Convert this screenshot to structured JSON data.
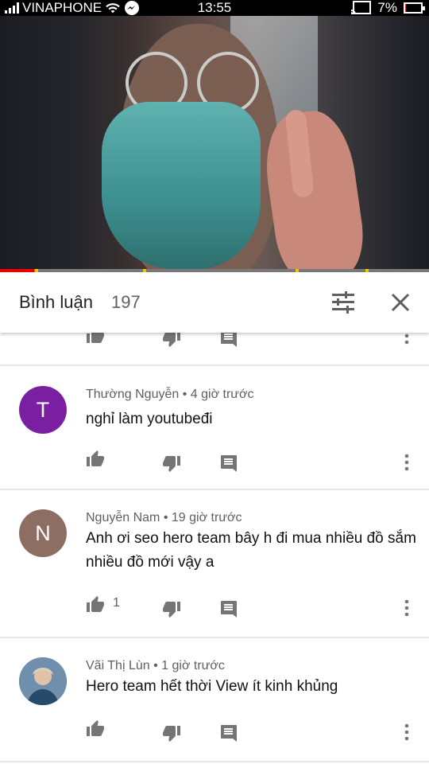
{
  "status_bar": {
    "carrier": "VINAPHONE",
    "time": "13:55",
    "battery": "7%",
    "battery_level": 0.07
  },
  "video": {
    "progress_played": 0.08
  },
  "comments": {
    "title": "Bình luận",
    "count": "197"
  },
  "comment_items": [
    {
      "author": "Thường Nguyễn",
      "time": "4 giờ trước",
      "text": "nghỉ làm youtubeđi",
      "avatar_letter": "T",
      "avatar_color": "#7b1fa2",
      "likes": ""
    },
    {
      "author": "Nguyễn Nam",
      "time": "19 giờ trước",
      "text": "Anh ơi seo hero team bây h đi mua nhiều đồ sắm nhiều đồ mới vậy a",
      "avatar_letter": "N",
      "avatar_color": "#8d6e63",
      "likes": "1"
    },
    {
      "author": "Vãi Thị Lùn",
      "time": "1 giờ trước",
      "text": "Hero team hết thời View ít kinh khủng",
      "avatar_letter": "",
      "avatar_color": "#3a5a78",
      "likes": ""
    }
  ],
  "icons": {
    "like": "thumb-up-icon",
    "dislike": "thumb-down-icon",
    "reply": "comment-icon",
    "more": "more-vert-icon",
    "filter": "sort-tune-icon",
    "close": "close-icon"
  }
}
